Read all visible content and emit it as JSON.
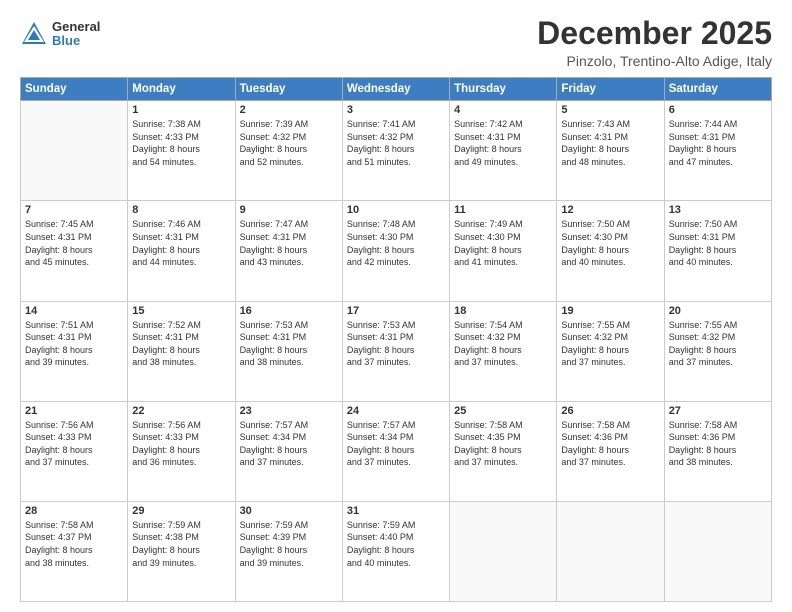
{
  "logo": {
    "general": "General",
    "blue": "Blue"
  },
  "title": "December 2025",
  "location": "Pinzolo, Trentino-Alto Adige, Italy",
  "days_header": [
    "Sunday",
    "Monday",
    "Tuesday",
    "Wednesday",
    "Thursday",
    "Friday",
    "Saturday"
  ],
  "weeks": [
    [
      {
        "day": "",
        "sunrise": "",
        "sunset": "",
        "daylight": ""
      },
      {
        "day": "1",
        "sunrise": "Sunrise: 7:38 AM",
        "sunset": "Sunset: 4:33 PM",
        "daylight": "Daylight: 8 hours and 54 minutes."
      },
      {
        "day": "2",
        "sunrise": "Sunrise: 7:39 AM",
        "sunset": "Sunset: 4:32 PM",
        "daylight": "Daylight: 8 hours and 52 minutes."
      },
      {
        "day": "3",
        "sunrise": "Sunrise: 7:41 AM",
        "sunset": "Sunset: 4:32 PM",
        "daylight": "Daylight: 8 hours and 51 minutes."
      },
      {
        "day": "4",
        "sunrise": "Sunrise: 7:42 AM",
        "sunset": "Sunset: 4:31 PM",
        "daylight": "Daylight: 8 hours and 49 minutes."
      },
      {
        "day": "5",
        "sunrise": "Sunrise: 7:43 AM",
        "sunset": "Sunset: 4:31 PM",
        "daylight": "Daylight: 8 hours and 48 minutes."
      },
      {
        "day": "6",
        "sunrise": "Sunrise: 7:44 AM",
        "sunset": "Sunset: 4:31 PM",
        "daylight": "Daylight: 8 hours and 47 minutes."
      }
    ],
    [
      {
        "day": "7",
        "sunrise": "Sunrise: 7:45 AM",
        "sunset": "Sunset: 4:31 PM",
        "daylight": "Daylight: 8 hours and 45 minutes."
      },
      {
        "day": "8",
        "sunrise": "Sunrise: 7:46 AM",
        "sunset": "Sunset: 4:31 PM",
        "daylight": "Daylight: 8 hours and 44 minutes."
      },
      {
        "day": "9",
        "sunrise": "Sunrise: 7:47 AM",
        "sunset": "Sunset: 4:31 PM",
        "daylight": "Daylight: 8 hours and 43 minutes."
      },
      {
        "day": "10",
        "sunrise": "Sunrise: 7:48 AM",
        "sunset": "Sunset: 4:30 PM",
        "daylight": "Daylight: 8 hours and 42 minutes."
      },
      {
        "day": "11",
        "sunrise": "Sunrise: 7:49 AM",
        "sunset": "Sunset: 4:30 PM",
        "daylight": "Daylight: 8 hours and 41 minutes."
      },
      {
        "day": "12",
        "sunrise": "Sunrise: 7:50 AM",
        "sunset": "Sunset: 4:30 PM",
        "daylight": "Daylight: 8 hours and 40 minutes."
      },
      {
        "day": "13",
        "sunrise": "Sunrise: 7:50 AM",
        "sunset": "Sunset: 4:31 PM",
        "daylight": "Daylight: 8 hours and 40 minutes."
      }
    ],
    [
      {
        "day": "14",
        "sunrise": "Sunrise: 7:51 AM",
        "sunset": "Sunset: 4:31 PM",
        "daylight": "Daylight: 8 hours and 39 minutes."
      },
      {
        "day": "15",
        "sunrise": "Sunrise: 7:52 AM",
        "sunset": "Sunset: 4:31 PM",
        "daylight": "Daylight: 8 hours and 38 minutes."
      },
      {
        "day": "16",
        "sunrise": "Sunrise: 7:53 AM",
        "sunset": "Sunset: 4:31 PM",
        "daylight": "Daylight: 8 hours and 38 minutes."
      },
      {
        "day": "17",
        "sunrise": "Sunrise: 7:53 AM",
        "sunset": "Sunset: 4:31 PM",
        "daylight": "Daylight: 8 hours and 37 minutes."
      },
      {
        "day": "18",
        "sunrise": "Sunrise: 7:54 AM",
        "sunset": "Sunset: 4:32 PM",
        "daylight": "Daylight: 8 hours and 37 minutes."
      },
      {
        "day": "19",
        "sunrise": "Sunrise: 7:55 AM",
        "sunset": "Sunset: 4:32 PM",
        "daylight": "Daylight: 8 hours and 37 minutes."
      },
      {
        "day": "20",
        "sunrise": "Sunrise: 7:55 AM",
        "sunset": "Sunset: 4:32 PM",
        "daylight": "Daylight: 8 hours and 37 minutes."
      }
    ],
    [
      {
        "day": "21",
        "sunrise": "Sunrise: 7:56 AM",
        "sunset": "Sunset: 4:33 PM",
        "daylight": "Daylight: 8 hours and 37 minutes."
      },
      {
        "day": "22",
        "sunrise": "Sunrise: 7:56 AM",
        "sunset": "Sunset: 4:33 PM",
        "daylight": "Daylight: 8 hours and 36 minutes."
      },
      {
        "day": "23",
        "sunrise": "Sunrise: 7:57 AM",
        "sunset": "Sunset: 4:34 PM",
        "daylight": "Daylight: 8 hours and 37 minutes."
      },
      {
        "day": "24",
        "sunrise": "Sunrise: 7:57 AM",
        "sunset": "Sunset: 4:34 PM",
        "daylight": "Daylight: 8 hours and 37 minutes."
      },
      {
        "day": "25",
        "sunrise": "Sunrise: 7:58 AM",
        "sunset": "Sunset: 4:35 PM",
        "daylight": "Daylight: 8 hours and 37 minutes."
      },
      {
        "day": "26",
        "sunrise": "Sunrise: 7:58 AM",
        "sunset": "Sunset: 4:36 PM",
        "daylight": "Daylight: 8 hours and 37 minutes."
      },
      {
        "day": "27",
        "sunrise": "Sunrise: 7:58 AM",
        "sunset": "Sunset: 4:36 PM",
        "daylight": "Daylight: 8 hours and 38 minutes."
      }
    ],
    [
      {
        "day": "28",
        "sunrise": "Sunrise: 7:58 AM",
        "sunset": "Sunset: 4:37 PM",
        "daylight": "Daylight: 8 hours and 38 minutes."
      },
      {
        "day": "29",
        "sunrise": "Sunrise: 7:59 AM",
        "sunset": "Sunset: 4:38 PM",
        "daylight": "Daylight: 8 hours and 39 minutes."
      },
      {
        "day": "30",
        "sunrise": "Sunrise: 7:59 AM",
        "sunset": "Sunset: 4:39 PM",
        "daylight": "Daylight: 8 hours and 39 minutes."
      },
      {
        "day": "31",
        "sunrise": "Sunrise: 7:59 AM",
        "sunset": "Sunset: 4:40 PM",
        "daylight": "Daylight: 8 hours and 40 minutes."
      },
      {
        "day": "",
        "sunrise": "",
        "sunset": "",
        "daylight": ""
      },
      {
        "day": "",
        "sunrise": "",
        "sunset": "",
        "daylight": ""
      },
      {
        "day": "",
        "sunrise": "",
        "sunset": "",
        "daylight": ""
      }
    ]
  ]
}
